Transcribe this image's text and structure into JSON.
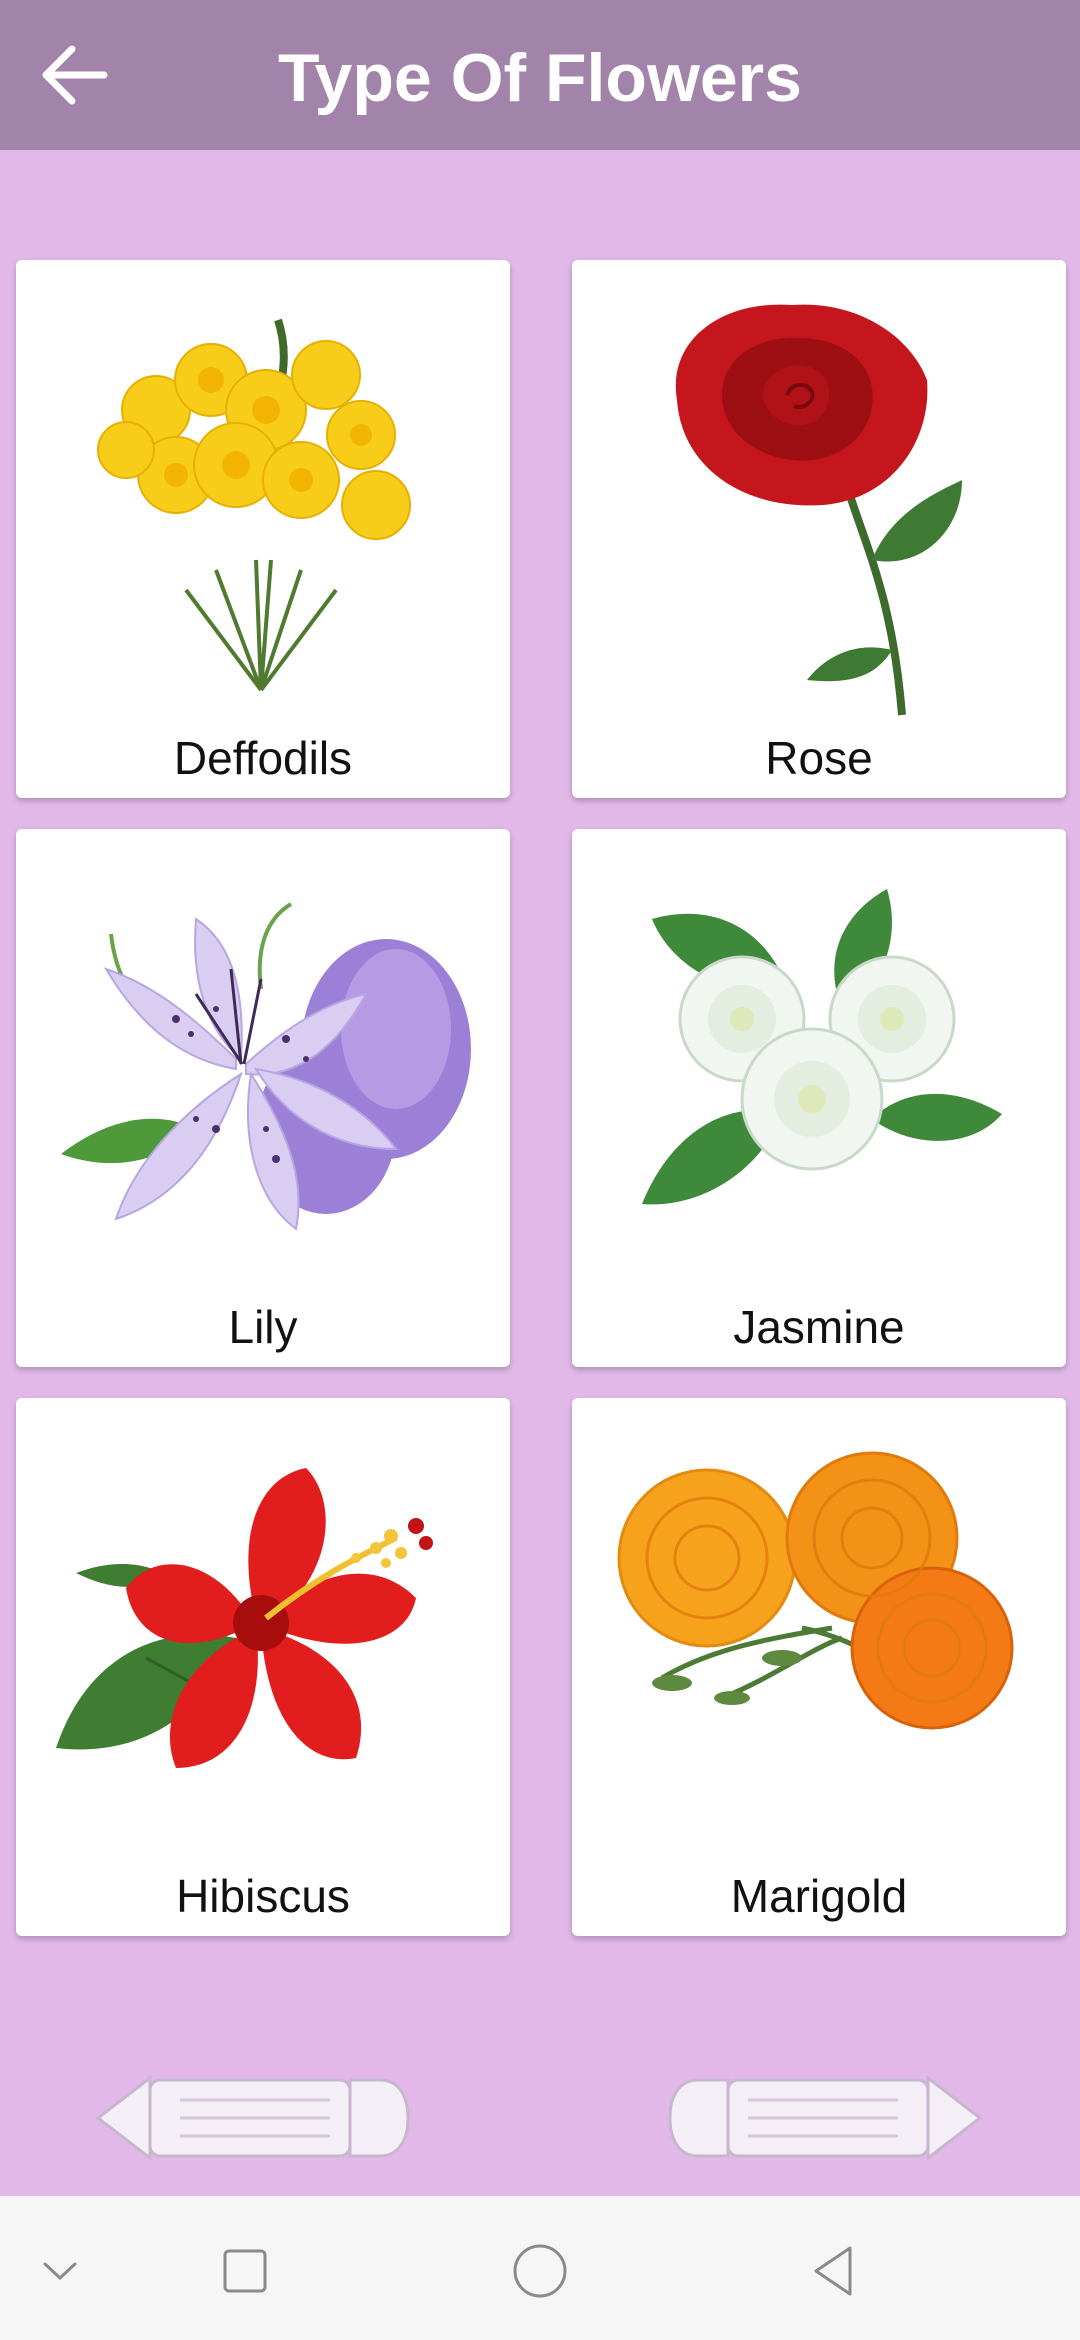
{
  "app_bar": {
    "title": "Type Of Flowers",
    "back_icon": "arrow-left-icon",
    "background": "#a283a9"
  },
  "page": {
    "background": "#e1b8e8"
  },
  "flowers": [
    {
      "label": "Deffodils",
      "image": "daffodil-image"
    },
    {
      "label": "Rose",
      "image": "rose-image"
    },
    {
      "label": "Lily",
      "image": "lily-image"
    },
    {
      "label": "Jasmine",
      "image": "jasmine-image"
    },
    {
      "label": "Hibiscus",
      "image": "hibiscus-image"
    },
    {
      "label": "Marigold",
      "image": "marigold-image"
    }
  ],
  "navigation": {
    "previous_icon": "pencil-arrow-left-icon",
    "next_icon": "pencil-arrow-right-icon"
  },
  "system_nav": {
    "icons": [
      "chevron-down-icon",
      "square-recents-icon",
      "circle-home-icon",
      "triangle-back-icon"
    ]
  }
}
